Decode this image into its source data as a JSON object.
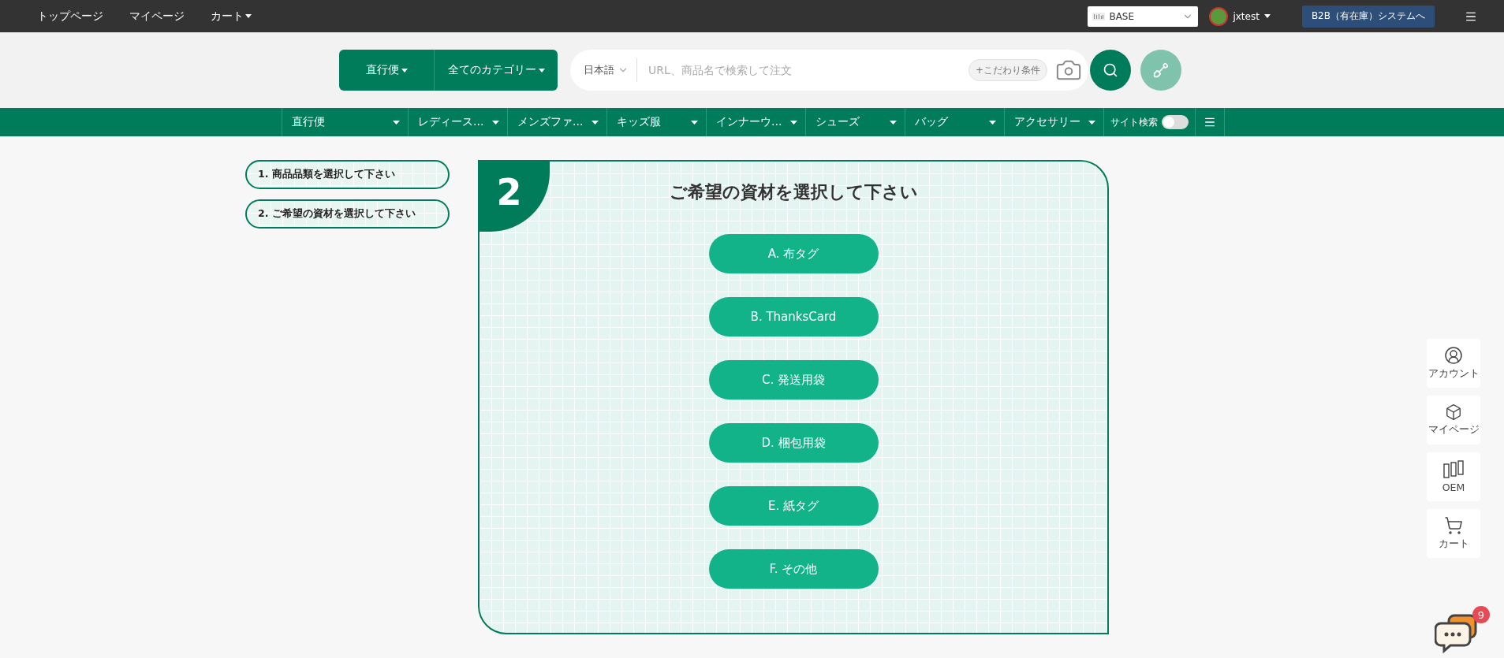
{
  "top_bar": {
    "links": [
      {
        "label": "トップページ",
        "dropdown": false
      },
      {
        "label": "マイページ",
        "dropdown": false
      },
      {
        "label": "カート",
        "dropdown": true
      }
    ],
    "region": "BASE",
    "user": "jxtest",
    "b2b_button": "B2B（有在庫）システムへ"
  },
  "search": {
    "shipping": "直行便",
    "category": "全てのカテゴリー",
    "language": "日本語",
    "placeholder": "URL、商品名で検索して注文",
    "filter": "+こだわり条件"
  },
  "nav": {
    "items": [
      {
        "label": "直行便"
      },
      {
        "label": "レディース..."
      },
      {
        "label": "メンズファ..."
      },
      {
        "label": "キッズ服"
      },
      {
        "label": "インナーウ..."
      },
      {
        "label": "シューズ"
      },
      {
        "label": "バッグ"
      },
      {
        "label": "アクセサリー"
      }
    ],
    "site_search": {
      "label": "サイト検索",
      "on": false
    }
  },
  "steps": [
    "1. 商品品類を選択して下さい",
    "2. ご希望の資材を選択して下さい"
  ],
  "panel": {
    "number": "2",
    "title": "ご希望の資材を選択して下さい",
    "options": [
      "A. 布タグ",
      "B. ThanksCard",
      "C. 発送用袋",
      "D. 梱包用袋",
      "E. 紙タグ",
      "F. その他"
    ]
  },
  "side_buttons": [
    {
      "kind": "account",
      "label": "アカウント"
    },
    {
      "kind": "mypage",
      "label": "マイページ"
    },
    {
      "kind": "oem",
      "label": "OEM"
    },
    {
      "kind": "cart",
      "label": "カート"
    }
  ],
  "chat": {
    "badge": "9"
  }
}
